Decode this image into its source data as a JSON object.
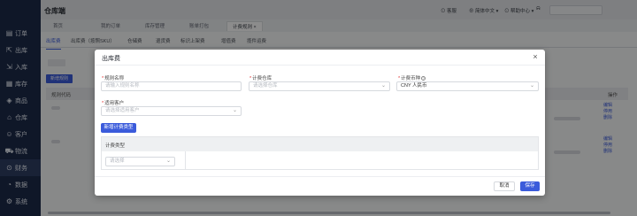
{
  "app": {
    "title": "仓库端"
  },
  "header": {
    "items": [
      "客服",
      "简体中文",
      "帮助中心"
    ]
  },
  "sidebar": {
    "items": [
      {
        "label": "订单",
        "icon": "order-icon"
      },
      {
        "label": "出库",
        "icon": "outbound-icon"
      },
      {
        "label": "入库",
        "icon": "inbound-icon"
      },
      {
        "label": "库存",
        "icon": "inventory-icon"
      },
      {
        "label": "商品",
        "icon": "product-icon"
      },
      {
        "label": "仓库",
        "icon": "warehouse-icon"
      },
      {
        "label": "客户",
        "icon": "customer-icon"
      },
      {
        "label": "物流",
        "icon": "logistics-icon"
      },
      {
        "label": "财务",
        "icon": "finance-icon"
      },
      {
        "label": "数据",
        "icon": "data-icon"
      },
      {
        "label": "系统",
        "icon": "system-icon"
      }
    ]
  },
  "tabs": [
    "首页",
    "我的订单",
    "库存管理",
    "账单打包",
    "计费规则"
  ],
  "subtabs": [
    "出库费",
    "出库费（按照SKU）",
    "仓储费",
    "退货费",
    "标识上架费",
    "增值费",
    "揽件运费"
  ],
  "page": {
    "add_rule_button": "新增规则",
    "table_headers": {
      "code": "规则代码",
      "operation": "操作"
    },
    "row_ops": [
      "编辑",
      "停用",
      "删除"
    ]
  },
  "modal": {
    "title": "出库费",
    "fields": {
      "rule_name": {
        "label": "规则名称",
        "placeholder": "请输入规则名称"
      },
      "warehouse": {
        "label": "计费仓库",
        "placeholder": "请选择仓库"
      },
      "currency": {
        "label": "计费币种",
        "info": "?",
        "value": "CNY 人民币"
      },
      "customer": {
        "label": "适用客户",
        "placeholder": "请选择适用客户"
      }
    },
    "add_fee_type_button": "新增计费类型",
    "fee_table": {
      "header": "计费类型",
      "select_placeholder": "请选择"
    },
    "cancel_button": "取消",
    "save_button": "保存"
  },
  "colors": {
    "accent": "#3b5bdb",
    "sidebar_bg": "#1d2b4a"
  }
}
